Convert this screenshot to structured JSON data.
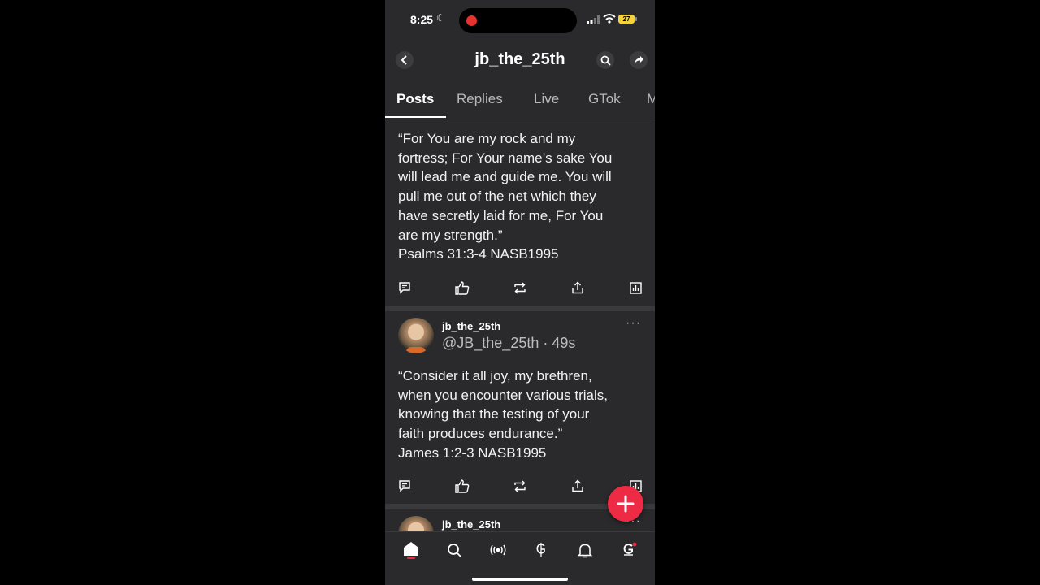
{
  "status_bar": {
    "time": "8:25",
    "battery": "27"
  },
  "header": {
    "title": "jb_the_25th"
  },
  "tabs": [
    {
      "label": "Posts",
      "active": true
    },
    {
      "label": "Replies"
    },
    {
      "label": "Live"
    },
    {
      "label": "GTok"
    },
    {
      "label": "M"
    }
  ],
  "posts": [
    {
      "lines": [
        "“For You are my rock and my",
        "fortress; For Your name’s sake You",
        "will lead me and guide me. You will",
        "pull me out of the net which they",
        "have secretly laid for me, For You",
        "are my strength.”",
        "Psalms 31:3-4 NASB1995"
      ]
    },
    {
      "author": "jb_the_25th",
      "handle_time": "@JB_the_25th · 49s",
      "lines": [
        "“Consider it all joy, my brethren,",
        "when you encounter various trials,",
        "knowing that the testing of your",
        "faith produces endurance.”",
        "James 1:2-3 NASB1995"
      ]
    },
    {
      "author": "jb_the_25th"
    }
  ],
  "more_glyph": "···",
  "colors": {
    "accent": "#ee2b44",
    "background": "#2a2a2c",
    "separator": "#3a3a3c",
    "recording": "#e8322e"
  },
  "icons": [
    "back-icon",
    "search-icon",
    "share-icon",
    "comment-icon",
    "like-icon",
    "repost-icon",
    "upload-icon",
    "stats-icon",
    "plus-icon",
    "home-icon",
    "explore-icon",
    "live-icon",
    "money-icon",
    "bell-icon",
    "gab-icon"
  ]
}
